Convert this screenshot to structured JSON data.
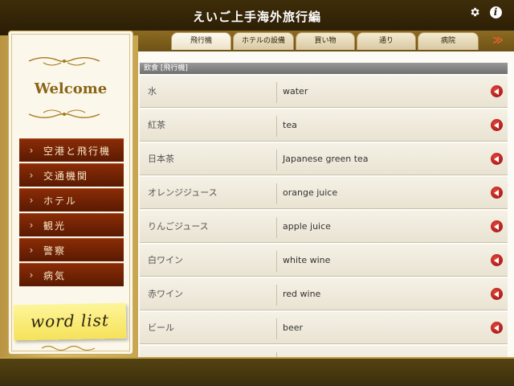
{
  "header": {
    "title": "えいご上手海外旅行編",
    "settings_icon": "gear-icon",
    "info_icon": "info-icon",
    "info_glyph": "i"
  },
  "tabs": [
    {
      "label": "飛行機",
      "active": true
    },
    {
      "label": "ホテルの設備",
      "active": false
    },
    {
      "label": "買い物",
      "active": false
    },
    {
      "label": "通り",
      "active": false
    },
    {
      "label": "病院",
      "active": false
    }
  ],
  "tabs_more": "≫",
  "sidebar": {
    "welcome": "Welcome",
    "items": [
      {
        "label": "空港と飛行機"
      },
      {
        "label": "交通機関"
      },
      {
        "label": "ホテル"
      },
      {
        "label": "観光"
      },
      {
        "label": "警察"
      },
      {
        "label": "病気"
      }
    ],
    "chevron": "›",
    "word_list": "word list"
  },
  "section": {
    "header": "飲食 [飛行機]"
  },
  "phrases": [
    {
      "ja": "水",
      "en": "water"
    },
    {
      "ja": "紅茶",
      "en": "tea"
    },
    {
      "ja": "日本茶",
      "en": "Japanese green tea"
    },
    {
      "ja": "オレンジジュース",
      "en": "orange juice"
    },
    {
      "ja": "りんごジュース",
      "en": "apple juice"
    },
    {
      "ja": "白ワイン",
      "en": "white wine"
    },
    {
      "ja": "赤ワイン",
      "en": "red wine"
    },
    {
      "ja": "ビール",
      "en": "beer"
    },
    {
      "ja": "",
      "en": ""
    }
  ],
  "colors": {
    "header_bg": "#2a1d05",
    "menu_item": "#6e2104",
    "speaker": "#c0141a",
    "accent_arrow": "#e8622b",
    "welcome_text": "#8a6418"
  }
}
